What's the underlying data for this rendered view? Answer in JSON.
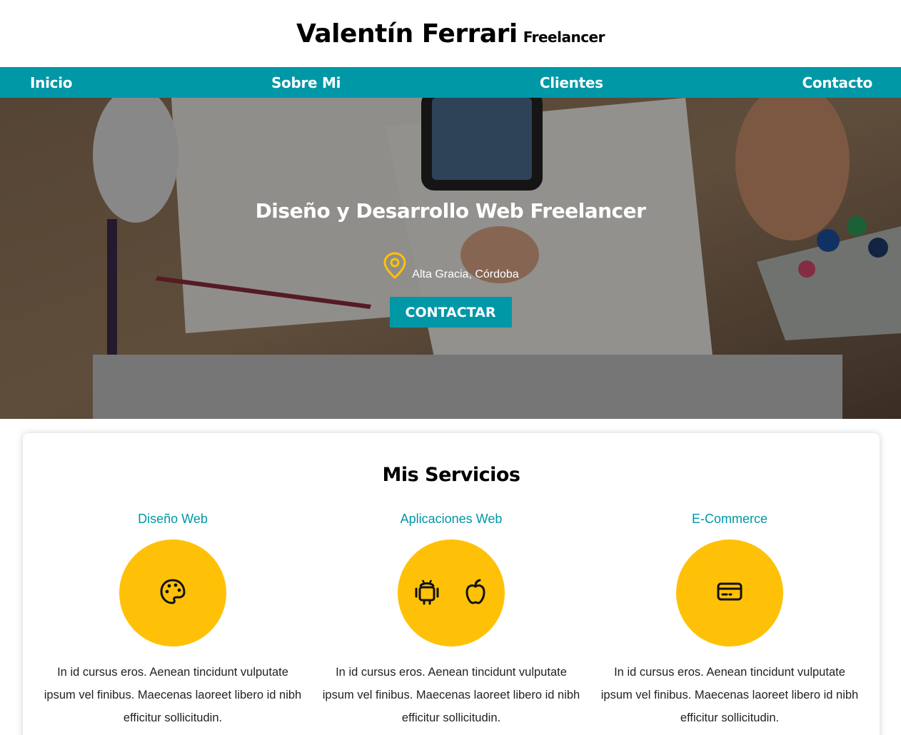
{
  "header": {
    "name": "Valentín Ferrari",
    "role": "Freelancer"
  },
  "nav": {
    "items": [
      "Inicio",
      "Sobre Mi",
      "Clientes",
      "Contacto"
    ]
  },
  "hero": {
    "title": "Diseño y Desarrollo Web Freelancer",
    "location": "Alta Gracia, Córdoba",
    "location_icon": "map-pin-icon",
    "button_label": "CONTACTAR"
  },
  "services": {
    "title": "Mis Servicios",
    "items": [
      {
        "title": "Diseño Web",
        "icons": [
          "palette-icon"
        ],
        "text": "In id cursus eros. Aenean tincidunt vulputate ipsum vel finibus. Maecenas laoreet libero id nibh efficitur sollicitudin."
      },
      {
        "title": "Aplicaciones Web",
        "icons": [
          "android-icon",
          "apple-icon"
        ],
        "text": "In id cursus eros. Aenean tincidunt vulputate ipsum vel finibus. Maecenas laoreet libero id nibh efficitur sollicitudin."
      },
      {
        "title": "E-Commerce",
        "icons": [
          "credit-card-icon"
        ],
        "text": "In id cursus eros. Aenean tincidunt vulputate ipsum vel finibus. Maecenas laoreet libero id nibh efficitur sollicitudin."
      }
    ]
  },
  "colors": {
    "accent": "#0097a7",
    "highlight": "#ffc107",
    "text": "#000000"
  }
}
